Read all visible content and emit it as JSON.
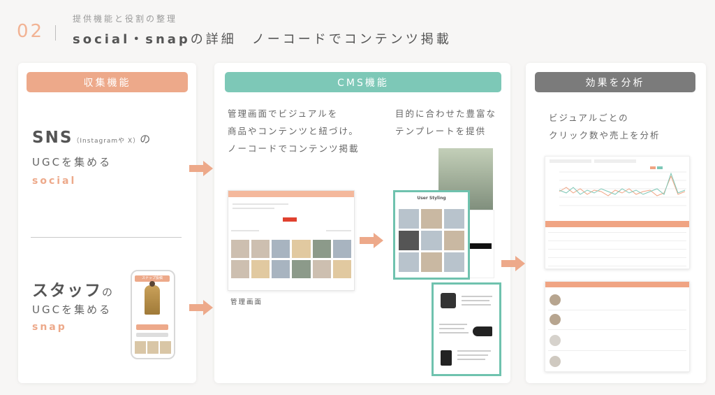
{
  "header": {
    "number": "02",
    "subtitle": "提供機能と役割の整理",
    "title_strong": "social・snap",
    "title_rest": "の詳細　ノーコードでコンテンツ掲載"
  },
  "collect": {
    "heading": "収集機能",
    "sns_title": "SNS",
    "sns_platforms": "（Instagramや X）",
    "sns_particle": "の",
    "sns_ugc": "UGCを集める",
    "sns_tag": "social",
    "staff_title": "スタッフ",
    "staff_particle": "の",
    "staff_ugc": "UGCを集める",
    "staff_tag": "snap",
    "phone_bar": "スナップ投稿"
  },
  "cms": {
    "heading": "CMS機能",
    "desc_left": [
      "管理画面でビジュアルを",
      "商品やコンテンツと紐づけ。",
      "ノーコードでコンテンツ掲載"
    ],
    "desc_right": [
      "目的に合わせた豊富な",
      "テンプレートを提供"
    ],
    "admin_caption": "管理画面",
    "template_title": "User Styling"
  },
  "effect": {
    "heading": "効果を分析",
    "desc": [
      "ビジュアルごとの",
      "クリック数や売上を分析"
    ]
  },
  "colors": {
    "accent_orange": "#eda98a",
    "accent_teal": "#7dc8b7",
    "accent_gray": "#7b7b7b"
  }
}
